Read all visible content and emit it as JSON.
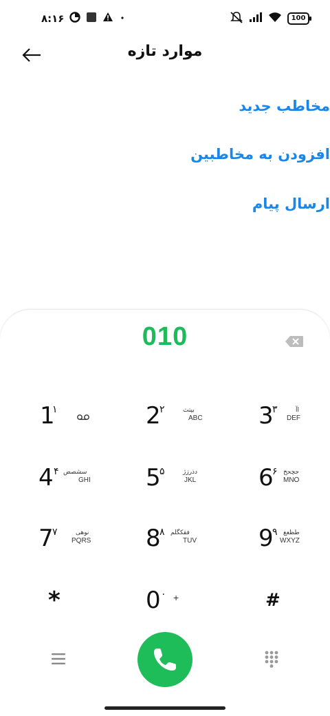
{
  "status_bar": {
    "time": "۸:۱۶",
    "battery": "100",
    "icons_left": [
      "data-saver-icon",
      "app-notification-icon",
      "warning-icon",
      "dot-icon"
    ],
    "icons_right": [
      "mute-icon",
      "signal-icon",
      "wifi-icon",
      "battery-icon"
    ]
  },
  "header": {
    "title": "موارد تازه"
  },
  "actions": [
    {
      "label": "مخاطب جدید"
    },
    {
      "label": "افزودن به مخاطبین"
    },
    {
      "label": "ارسال پیام"
    }
  ],
  "dialer": {
    "number": "010",
    "accent_color": "#1dbb59",
    "keys": [
      {
        "digit": "1",
        "persian": "۱",
        "fa": "",
        "en": "",
        "extra": "voicemail-icon"
      },
      {
        "digit": "2",
        "persian": "۲",
        "fa": "بپتث",
        "en": "ABC"
      },
      {
        "digit": "3",
        "persian": "۳",
        "fa": "اآ",
        "en": "DEF"
      },
      {
        "digit": "4",
        "persian": "۴",
        "fa": "سشصض",
        "en": "GHI"
      },
      {
        "digit": "5",
        "persian": "۵",
        "fa": "دذرزژ",
        "en": "JKL"
      },
      {
        "digit": "6",
        "persian": "۶",
        "fa": "جچحخ",
        "en": "MNO"
      },
      {
        "digit": "7",
        "persian": "۷",
        "fa": "نوهی",
        "en": "PQRS"
      },
      {
        "digit": "8",
        "persian": "۸",
        "fa": "فقکگلم",
        "en": "TUV"
      },
      {
        "digit": "9",
        "persian": "۹",
        "fa": "طظعغ",
        "en": "WXYZ"
      },
      {
        "digit": "*",
        "persian": "",
        "fa": "",
        "en": ""
      },
      {
        "digit": "0",
        "persian": "۰",
        "fa": "",
        "en": "+"
      },
      {
        "digit": "#",
        "persian": "",
        "fa": "",
        "en": ""
      }
    ]
  },
  "bottom_bar": {
    "call_color": "#1fbc5a",
    "icons": [
      "menu-icon",
      "phone-icon",
      "keypad-icon"
    ]
  }
}
